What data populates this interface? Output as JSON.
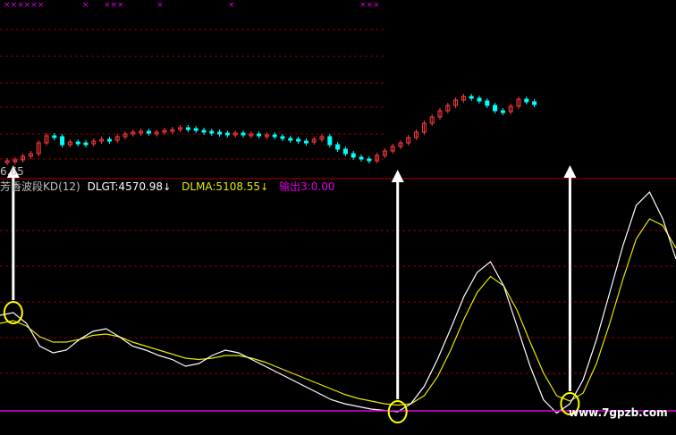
{
  "price_panel": {
    "current_price_label": "6.65",
    "top_markers": [
      "××××××",
      "×",
      "×××",
      "×",
      "×",
      "×××"
    ]
  },
  "indicator": {
    "name": "芳香波段KD(12)",
    "dlgt_label": "DLGT:4570.98",
    "dlgt_arrow": "↓",
    "dlma_label": "DLMA:5108.55",
    "dlma_arrow": "↓",
    "output_label": "输出3:0.00"
  },
  "watermark": "www.7gpzb.com",
  "colors": {
    "background": "#000000",
    "grid": "#8b0000",
    "divider": "#b00000",
    "candle_up": "#ff3c3c",
    "candle_down": "#00ffff",
    "dlgt_line": "#ffffff",
    "dlma_line": "#e8e800",
    "output_line": "#e000e0",
    "signal_circle": "#ffff00",
    "signal_arrow": "#ffffff"
  },
  "series": {
    "candles_close": [
      180,
      179,
      175,
      172,
      160,
      152,
      153,
      162,
      159,
      160,
      161,
      158,
      156,
      157,
      153,
      150,
      148,
      147,
      149,
      148,
      146,
      145,
      143,
      144,
      146,
      147,
      148,
      149,
      150,
      149,
      151,
      150,
      152,
      151,
      153,
      155,
      156,
      158,
      159,
      156,
      153,
      162,
      167,
      172,
      176,
      178,
      180,
      174,
      169,
      164,
      160,
      154,
      148,
      138,
      131,
      124,
      118,
      112,
      108,
      110,
      113,
      118,
      124,
      125,
      119,
      111,
      114,
      117
    ],
    "dlgt": [
      78,
      80,
      72,
      55,
      50,
      52,
      60,
      66,
      68,
      62,
      55,
      52,
      48,
      45,
      40,
      42,
      48,
      52,
      50,
      45,
      40,
      35,
      30,
      25,
      20,
      15,
      12,
      10,
      8,
      7,
      6,
      12,
      25,
      45,
      68,
      92,
      110,
      118,
      100,
      70,
      40,
      15,
      5,
      12,
      30,
      60,
      95,
      130,
      160,
      170,
      150,
      120
    ],
    "dlma": [
      72,
      74,
      70,
      62,
      58,
      58,
      60,
      63,
      64,
      62,
      58,
      55,
      52,
      49,
      46,
      45,
      46,
      48,
      48,
      46,
      43,
      39,
      35,
      31,
      27,
      23,
      19,
      16,
      14,
      12,
      11,
      12,
      18,
      32,
      52,
      75,
      95,
      107,
      100,
      82,
      58,
      35,
      18,
      14,
      20,
      42,
      72,
      105,
      135,
      150,
      145,
      128
    ],
    "output_level": 0,
    "signals": [
      {
        "index": 1,
        "label": "buy"
      },
      {
        "index": 30,
        "label": "buy"
      },
      {
        "index": 43,
        "label": "buy"
      }
    ]
  }
}
